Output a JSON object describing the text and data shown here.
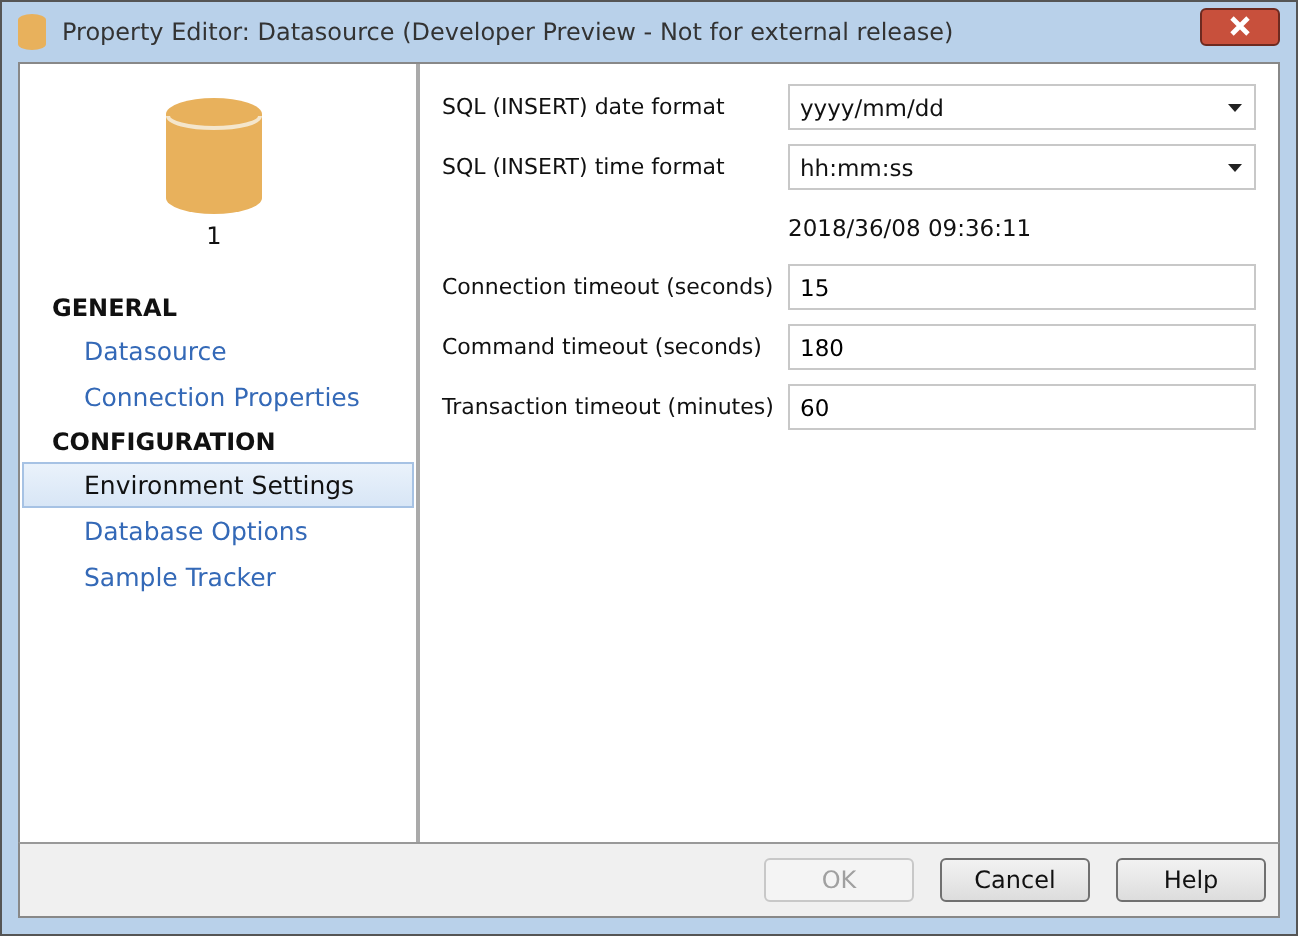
{
  "window": {
    "title": "Property Editor:  Datasource (Developer Preview - Not for external release)"
  },
  "sidebar": {
    "caption": "1",
    "sections": [
      {
        "heading": "GENERAL",
        "items": [
          {
            "label": "Datasource",
            "selected": false
          },
          {
            "label": "Connection Properties",
            "selected": false
          }
        ]
      },
      {
        "heading": "CONFIGURATION",
        "items": [
          {
            "label": "Environment Settings",
            "selected": true
          },
          {
            "label": "Database Options",
            "selected": false
          },
          {
            "label": "Sample Tracker",
            "selected": false
          }
        ]
      }
    ]
  },
  "settings": [
    {
      "kind": "dropdown",
      "label": "SQL (INSERT) date format",
      "value": "yyyy/mm/dd"
    },
    {
      "kind": "dropdown",
      "label": "SQL (INSERT) time format",
      "value": "hh:mm:ss"
    },
    {
      "kind": "note",
      "value": "2018/36/08 09:36:11"
    },
    {
      "kind": "text",
      "label": "Connection timeout (seconds)",
      "value": "15"
    },
    {
      "kind": "text",
      "label": "Command timeout (seconds)",
      "value": "180"
    },
    {
      "kind": "text",
      "label": "Transaction timeout (minutes)",
      "value": "60"
    }
  ],
  "buttons": [
    {
      "label": "OK",
      "disabled": true
    },
    {
      "label": "Cancel",
      "disabled": false
    },
    {
      "label": "Help",
      "disabled": false
    }
  ]
}
